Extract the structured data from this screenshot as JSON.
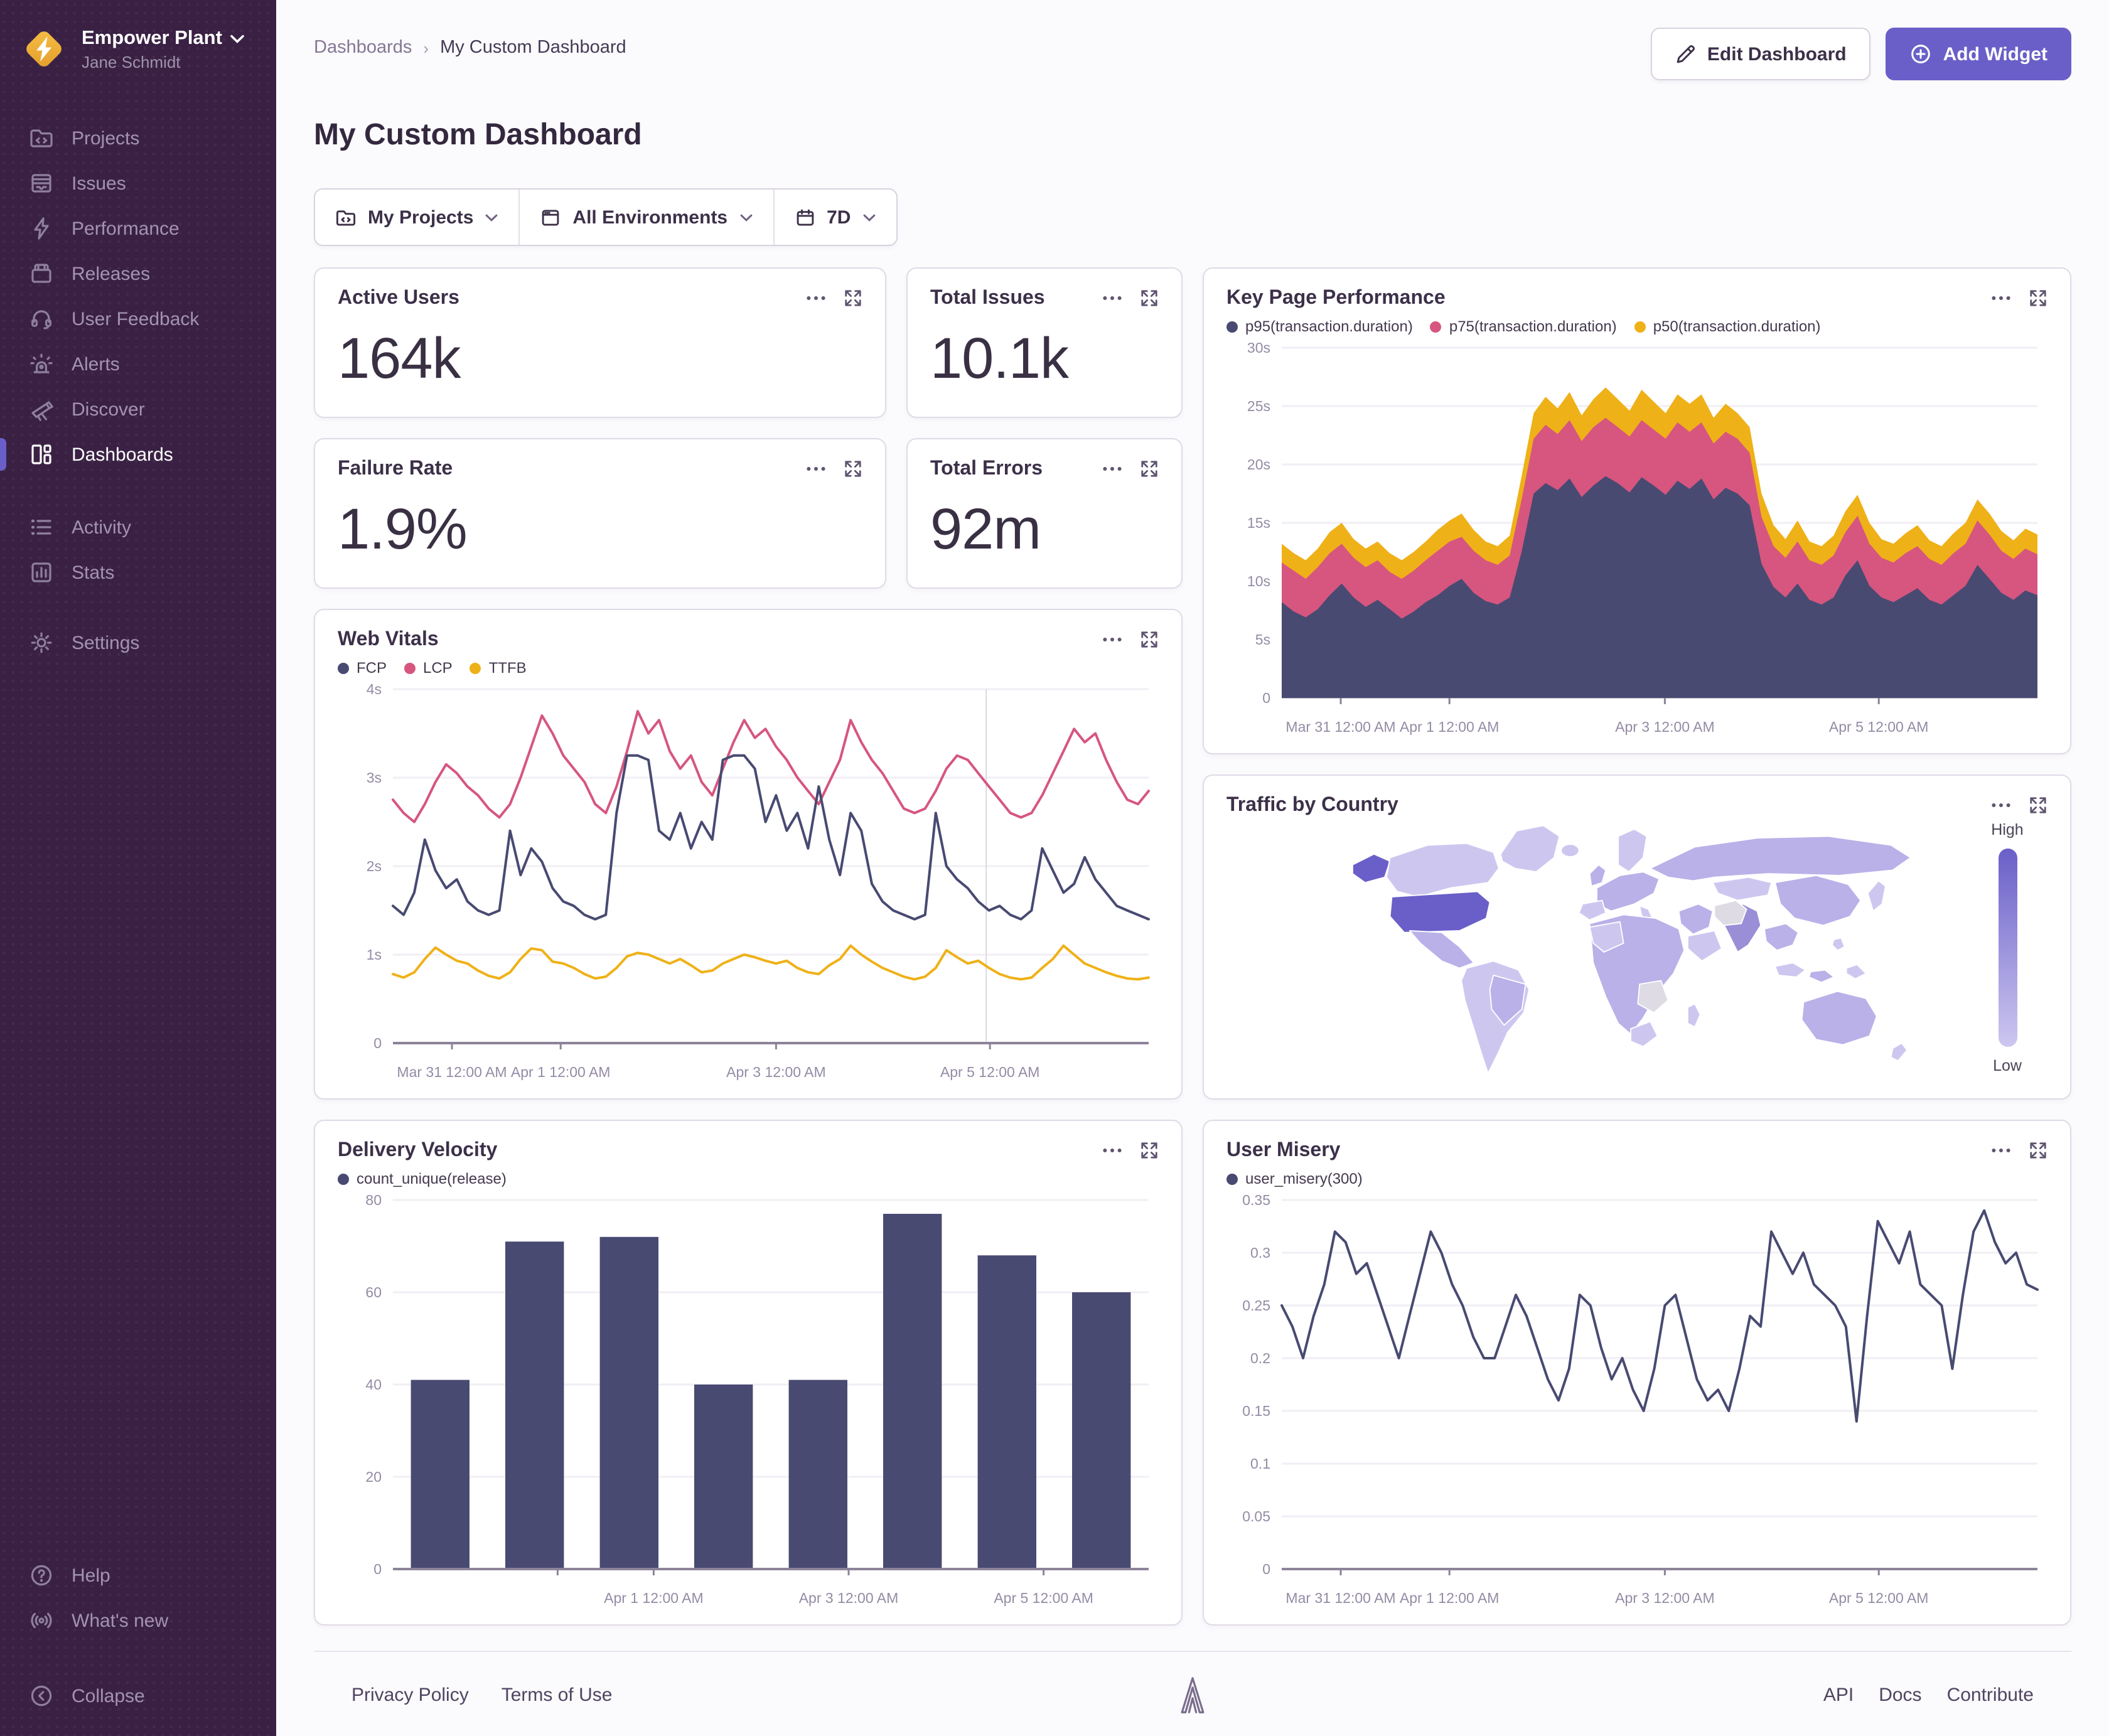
{
  "sidebar": {
    "org_name": "Empower Plant",
    "user_name": "Jane Schmidt",
    "nav": [
      {
        "label": "Projects"
      },
      {
        "label": "Issues"
      },
      {
        "label": "Performance"
      },
      {
        "label": "Releases"
      },
      {
        "label": "User Feedback"
      },
      {
        "label": "Alerts"
      },
      {
        "label": "Discover"
      },
      {
        "label": "Dashboards",
        "active": true
      },
      {
        "label": "Activity"
      },
      {
        "label": "Stats"
      },
      {
        "label": "Settings"
      }
    ],
    "bottom": [
      {
        "label": "Help"
      },
      {
        "label": "What's new"
      },
      {
        "label": "Collapse"
      }
    ]
  },
  "header": {
    "breadcrumb_parent": "Dashboards",
    "breadcrumb_current": "My Custom Dashboard",
    "title": "My Custom Dashboard",
    "edit_button": "Edit Dashboard",
    "add_button": "Add Widget"
  },
  "filters": {
    "projects": "My Projects",
    "environments": "All Environments",
    "period": "7D"
  },
  "stat_cards": [
    {
      "title": "Active Users",
      "value": "164k"
    },
    {
      "title": "Total Issues",
      "value": "10.1k"
    },
    {
      "title": "Failure Rate",
      "value": "1.9%"
    },
    {
      "title": "Total Errors",
      "value": "92m"
    }
  ],
  "colors": {
    "accent": "#6A5FC8",
    "navy": "#484A72",
    "pink": "#D6567F",
    "yellow": "#EFB118",
    "map_high": "#6A5FC8",
    "map_low": "#CDC7F0"
  },
  "map": {
    "legend_high": "High",
    "legend_low": "Low"
  },
  "chart_data": [
    {
      "id": "key-page-performance",
      "type": "area",
      "title": "Key Page Performance",
      "ylabel": "seconds",
      "ylim": [
        0,
        30
      ],
      "grid": true,
      "legend_position": "top",
      "yticks": [
        {
          "v": 0,
          "l": "0"
        },
        {
          "v": 5,
          "l": "5s"
        },
        {
          "v": 10,
          "l": "10s"
        },
        {
          "v": 15,
          "l": "15s"
        },
        {
          "v": 20,
          "l": "20s"
        },
        {
          "v": 25,
          "l": "25s"
        },
        {
          "v": 30,
          "l": "30s"
        }
      ],
      "xticks": [
        {
          "f": 0.078,
          "l": "Mar 31 12:00 AM"
        },
        {
          "f": 0.222,
          "l": "Apr 1 12:00 AM"
        },
        {
          "f": 0.507,
          "l": "Apr 3 12:00 AM"
        },
        {
          "f": 0.79,
          "l": "Apr 5 12:00 AM"
        }
      ],
      "draw_order": [
        2,
        1,
        0
      ],
      "series": [
        {
          "name": "p95(transaction.duration)",
          "color": "#484A72",
          "values": [
            8.2,
            7.4,
            6.9,
            7.6,
            8.8,
            9.8,
            8.6,
            7.8,
            8.4,
            7.6,
            6.8,
            7.4,
            8.2,
            8.8,
            9.6,
            10.2,
            9.0,
            8.3,
            8.0,
            8.6,
            12.5,
            17.5,
            18.4,
            17.8,
            18.8,
            17.2,
            18.2,
            19.0,
            18.4,
            17.6,
            18.9,
            18.2,
            17.4,
            18.6,
            17.9,
            18.8,
            17.0,
            18.0,
            17.5,
            16.5,
            11.5,
            9.5,
            8.6,
            9.8,
            8.4,
            8.0,
            8.6,
            10.5,
            11.8,
            9.6,
            8.6,
            8.2,
            8.8,
            9.4,
            8.4,
            8.0,
            8.8,
            9.6,
            11.4,
            10.2,
            9.0,
            8.4,
            9.2,
            8.8
          ]
        },
        {
          "name": "p75(transaction.duration)",
          "color": "#D6567F",
          "values": [
            11.6,
            10.9,
            10.2,
            11.2,
            12.4,
            13.2,
            12.0,
            11.2,
            11.8,
            10.8,
            10.2,
            10.9,
            11.8,
            12.6,
            13.4,
            13.8,
            12.6,
            11.8,
            11.4,
            12.2,
            17.0,
            22.2,
            23.4,
            22.6,
            23.8,
            22.0,
            23.2,
            24.0,
            23.2,
            22.4,
            23.8,
            23.0,
            22.2,
            23.6,
            22.8,
            23.6,
            21.8,
            22.8,
            22.2,
            21.0,
            15.5,
            13.0,
            12.0,
            13.4,
            11.8,
            11.4,
            12.2,
            14.2,
            15.6,
            13.2,
            12.0,
            11.6,
            12.4,
            13.0,
            11.9,
            11.4,
            12.4,
            13.2,
            15.2,
            14.0,
            12.6,
            11.9,
            12.8,
            12.3
          ]
        },
        {
          "name": "p50(transaction.duration)",
          "color": "#EFB118",
          "values": [
            13.2,
            12.4,
            11.8,
            12.8,
            14.2,
            15.0,
            13.6,
            12.8,
            13.4,
            12.4,
            11.8,
            12.5,
            13.4,
            14.4,
            15.2,
            15.8,
            14.4,
            13.4,
            13.0,
            13.9,
            19.0,
            24.4,
            25.8,
            24.8,
            26.2,
            24.2,
            25.6,
            26.6,
            25.6,
            24.6,
            26.4,
            25.4,
            24.4,
            26.0,
            25.2,
            26.0,
            24.0,
            25.2,
            24.4,
            23.2,
            17.5,
            14.8,
            13.6,
            15.2,
            13.4,
            13.0,
            13.9,
            16.0,
            17.4,
            15.0,
            13.6,
            13.2,
            14.1,
            14.8,
            13.5,
            13.0,
            14.1,
            15.0,
            17.0,
            15.8,
            14.3,
            13.5,
            14.5,
            14.0
          ]
        }
      ]
    },
    {
      "id": "web-vitals",
      "type": "line",
      "title": "Web Vitals",
      "ylabel": "seconds",
      "ylim": [
        0,
        4
      ],
      "grid": true,
      "vline": 0.785,
      "yticks": [
        {
          "v": 0,
          "l": "0"
        },
        {
          "v": 1,
          "l": "1s"
        },
        {
          "v": 2,
          "l": "2s"
        },
        {
          "v": 3,
          "l": "3s"
        },
        {
          "v": 4,
          "l": "4s"
        }
      ],
      "xticks": [
        {
          "f": 0.078,
          "l": "Mar 31 12:00 AM"
        },
        {
          "f": 0.222,
          "l": "Apr 1 12:00 AM"
        },
        {
          "f": 0.507,
          "l": "Apr 3 12:00 AM"
        },
        {
          "f": 0.79,
          "l": "Apr 5 12:00 AM"
        }
      ],
      "draw_order": [
        1,
        2,
        0
      ],
      "series": [
        {
          "name": "FCP",
          "color": "#484A72",
          "values": [
            1.55,
            1.45,
            1.7,
            2.3,
            1.95,
            1.75,
            1.85,
            1.6,
            1.5,
            1.45,
            1.5,
            2.4,
            1.9,
            2.2,
            2.05,
            1.75,
            1.6,
            1.55,
            1.45,
            1.4,
            1.45,
            2.6,
            3.25,
            3.25,
            3.2,
            2.4,
            2.3,
            2.6,
            2.2,
            2.5,
            2.3,
            3.2,
            3.25,
            3.25,
            3.1,
            2.5,
            2.8,
            2.4,
            2.6,
            2.2,
            2.9,
            2.3,
            1.9,
            2.6,
            2.4,
            1.8,
            1.6,
            1.5,
            1.45,
            1.4,
            1.45,
            2.6,
            2.0,
            1.85,
            1.75,
            1.6,
            1.5,
            1.55,
            1.45,
            1.4,
            1.5,
            2.2,
            1.95,
            1.7,
            1.8,
            2.1,
            1.85,
            1.7,
            1.55,
            1.5,
            1.45,
            1.4
          ]
        },
        {
          "name": "LCP",
          "color": "#D6567F",
          "values": [
            2.75,
            2.6,
            2.5,
            2.7,
            2.95,
            3.15,
            3.05,
            2.9,
            2.8,
            2.65,
            2.55,
            2.7,
            3.0,
            3.35,
            3.7,
            3.5,
            3.25,
            3.1,
            2.95,
            2.7,
            2.6,
            2.9,
            3.3,
            3.75,
            3.5,
            3.65,
            3.3,
            3.1,
            3.25,
            2.95,
            2.8,
            3.1,
            3.4,
            3.65,
            3.45,
            3.55,
            3.35,
            3.2,
            3.0,
            2.85,
            2.7,
            2.95,
            3.2,
            3.65,
            3.4,
            3.2,
            3.05,
            2.85,
            2.65,
            2.6,
            2.65,
            2.85,
            3.1,
            3.25,
            3.2,
            3.05,
            2.9,
            2.75,
            2.6,
            2.55,
            2.6,
            2.8,
            3.05,
            3.3,
            3.55,
            3.4,
            3.5,
            3.2,
            2.95,
            2.75,
            2.7,
            2.85
          ]
        },
        {
          "name": "TTFB",
          "color": "#EFB118",
          "values": [
            0.78,
            0.74,
            0.8,
            0.95,
            1.08,
            1.0,
            0.93,
            0.9,
            0.82,
            0.76,
            0.73,
            0.8,
            0.95,
            1.07,
            1.05,
            0.92,
            0.9,
            0.85,
            0.78,
            0.73,
            0.75,
            0.85,
            0.98,
            1.02,
            1.0,
            0.95,
            0.9,
            0.95,
            0.88,
            0.8,
            0.82,
            0.9,
            0.95,
            1.0,
            0.97,
            0.93,
            0.9,
            0.93,
            0.85,
            0.8,
            0.78,
            0.88,
            0.95,
            1.1,
            1.0,
            0.92,
            0.85,
            0.8,
            0.75,
            0.72,
            0.75,
            0.85,
            1.05,
            0.97,
            0.9,
            0.93,
            0.85,
            0.78,
            0.74,
            0.72,
            0.74,
            0.85,
            0.95,
            1.1,
            1.0,
            0.9,
            0.85,
            0.8,
            0.76,
            0.73,
            0.72,
            0.74
          ]
        }
      ]
    },
    {
      "id": "traffic-by-country",
      "type": "map",
      "title": "Traffic by Country",
      "legend_high": "High",
      "legend_low": "Low",
      "highest_country": "United States"
    },
    {
      "id": "delivery-velocity",
      "type": "bar",
      "title": "Delivery Velocity",
      "ylim": [
        0,
        80
      ],
      "grid": true,
      "yticks": [
        {
          "v": 0,
          "l": "0"
        },
        {
          "v": 20,
          "l": "20"
        },
        {
          "v": 40,
          "l": "40"
        },
        {
          "v": 60,
          "l": "60"
        },
        {
          "v": 80,
          "l": "80"
        }
      ],
      "xticks": [
        {
          "f": 0.218,
          "l": ""
        },
        {
          "f": 0.345,
          "l": "Apr 1 12:00 AM"
        },
        {
          "f": 0.603,
          "l": "Apr 3 12:00 AM"
        },
        {
          "f": 0.861,
          "l": "Apr 5 12:00 AM"
        }
      ],
      "series": [
        {
          "name": "count_unique(release)",
          "color": "#484A72",
          "values": [
            41,
            71,
            72,
            40,
            41,
            77,
            68,
            60
          ]
        }
      ]
    },
    {
      "id": "user-misery",
      "type": "line",
      "title": "User Misery",
      "ylim": [
        0,
        0.35
      ],
      "grid": true,
      "yticks": [
        {
          "v": 0,
          "l": "0"
        },
        {
          "v": 0.05,
          "l": "0.05"
        },
        {
          "v": 0.1,
          "l": "0.1"
        },
        {
          "v": 0.15,
          "l": "0.15"
        },
        {
          "v": 0.2,
          "l": "0.2"
        },
        {
          "v": 0.25,
          "l": "0.25"
        },
        {
          "v": 0.3,
          "l": "0.3"
        },
        {
          "v": 0.35,
          "l": "0.35"
        }
      ],
      "xticks": [
        {
          "f": 0.078,
          "l": "Mar 31 12:00 AM"
        },
        {
          "f": 0.222,
          "l": "Apr 1 12:00 AM"
        },
        {
          "f": 0.507,
          "l": "Apr 3 12:00 AM"
        },
        {
          "f": 0.79,
          "l": "Apr 5 12:00 AM"
        }
      ],
      "series": [
        {
          "name": "user_misery(300)",
          "color": "#484A72",
          "values": [
            0.25,
            0.23,
            0.2,
            0.24,
            0.27,
            0.32,
            0.31,
            0.28,
            0.29,
            0.26,
            0.23,
            0.2,
            0.24,
            0.28,
            0.32,
            0.3,
            0.27,
            0.25,
            0.22,
            0.2,
            0.2,
            0.23,
            0.26,
            0.24,
            0.21,
            0.18,
            0.16,
            0.19,
            0.26,
            0.25,
            0.21,
            0.18,
            0.2,
            0.17,
            0.15,
            0.19,
            0.25,
            0.26,
            0.22,
            0.18,
            0.16,
            0.17,
            0.15,
            0.19,
            0.24,
            0.23,
            0.32,
            0.3,
            0.28,
            0.3,
            0.27,
            0.26,
            0.25,
            0.23,
            0.14,
            0.24,
            0.33,
            0.31,
            0.29,
            0.32,
            0.27,
            0.26,
            0.25,
            0.19,
            0.26,
            0.32,
            0.34,
            0.31,
            0.29,
            0.3,
            0.27,
            0.265
          ]
        }
      ]
    }
  ],
  "footer": {
    "privacy": "Privacy Policy",
    "terms": "Terms of Use",
    "api": "API",
    "docs": "Docs",
    "contribute": "Contribute"
  }
}
